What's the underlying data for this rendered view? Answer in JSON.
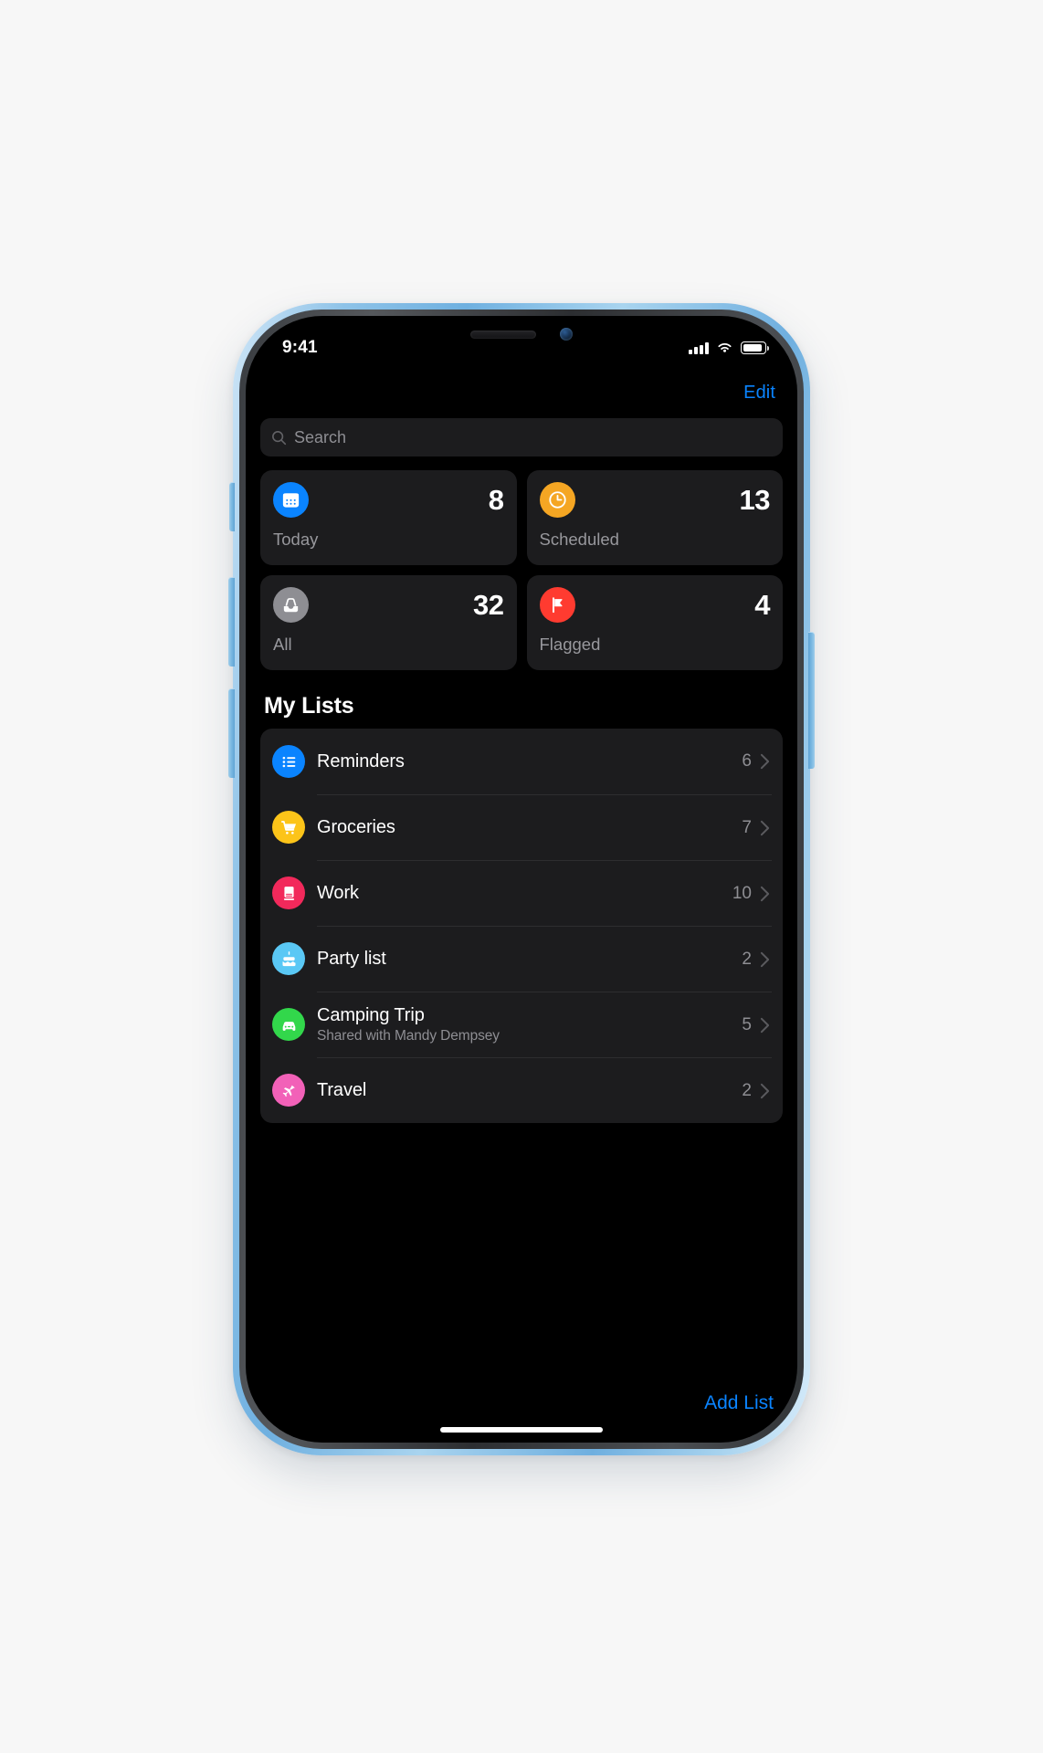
{
  "status_bar": {
    "time": "9:41",
    "signal_icon": "cellular-signal-icon",
    "wifi_icon": "wifi-icon",
    "battery_icon": "battery-icon",
    "signal_bars": 4,
    "battery_level": 88
  },
  "nav": {
    "edit_label": "Edit"
  },
  "search": {
    "placeholder": "Search",
    "icon": "search-icon",
    "value": ""
  },
  "smart_lists": [
    {
      "id": "today",
      "label": "Today",
      "count": "8",
      "icon": "calendar-icon",
      "color": "#0a84ff"
    },
    {
      "id": "scheduled",
      "label": "Scheduled",
      "count": "13",
      "icon": "clock-icon",
      "color": "#f5a623"
    },
    {
      "id": "all",
      "label": "All",
      "count": "32",
      "icon": "inbox-icon",
      "color": "#8e8e93"
    },
    {
      "id": "flagged",
      "label": "Flagged",
      "count": "4",
      "icon": "flag-icon",
      "color": "#ff3b30"
    }
  ],
  "my_lists": {
    "title": "My Lists",
    "items": [
      {
        "id": "reminders",
        "name": "Reminders",
        "subtitle": "",
        "count": "6",
        "icon": "bullet-list-icon",
        "color": "#0a84ff"
      },
      {
        "id": "groceries",
        "name": "Groceries",
        "subtitle": "",
        "count": "7",
        "icon": "shopping-cart-icon",
        "color": "#fcc419"
      },
      {
        "id": "work",
        "name": "Work",
        "subtitle": "",
        "count": "10",
        "icon": "computer-icon",
        "color": "#f2295b"
      },
      {
        "id": "party-list",
        "name": "Party list",
        "subtitle": "",
        "count": "2",
        "icon": "birthday-cake-icon",
        "color": "#5ac8f5"
      },
      {
        "id": "camping-trip",
        "name": "Camping Trip",
        "subtitle": "Shared with Mandy Dempsey",
        "count": "5",
        "icon": "car-icon",
        "color": "#32d74b"
      },
      {
        "id": "travel",
        "name": "Travel",
        "subtitle": "",
        "count": "2",
        "icon": "airplane-icon",
        "color": "#f261b8"
      }
    ],
    "chevron_icon": "chevron-right-icon"
  },
  "bottom": {
    "add_list_label": "Add List"
  },
  "theme": {
    "accent_blue": "#0a84ff",
    "screen_bg": "#000000",
    "card_bg": "#1c1c1e",
    "secondary_text": "#8e8e93",
    "device_frame": "#8fc3e8"
  }
}
